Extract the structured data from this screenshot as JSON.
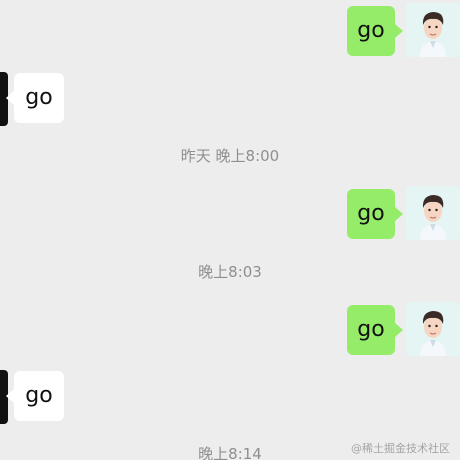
{
  "colors": {
    "background": "#ededed",
    "sent_bubble": "#95ec69",
    "received_bubble": "#ffffff",
    "timestamp_text": "#8f8f8f"
  },
  "messages": [
    {
      "direction": "sent",
      "text": "go"
    },
    {
      "direction": "received",
      "text": "go"
    },
    {
      "type": "timestamp",
      "text": "昨天 晚上8:00"
    },
    {
      "direction": "sent",
      "text": "go"
    },
    {
      "type": "timestamp",
      "text": "晚上8:03"
    },
    {
      "direction": "sent",
      "text": "go"
    },
    {
      "direction": "received",
      "text": "go"
    },
    {
      "type": "timestamp",
      "text": "晚上8:14"
    }
  ],
  "watermark": "@稀土掘金技术社区",
  "icons": {
    "own_avatar": "cartoon-man-avatar-icon",
    "contact_avatar": "contact-avatar-icon"
  }
}
